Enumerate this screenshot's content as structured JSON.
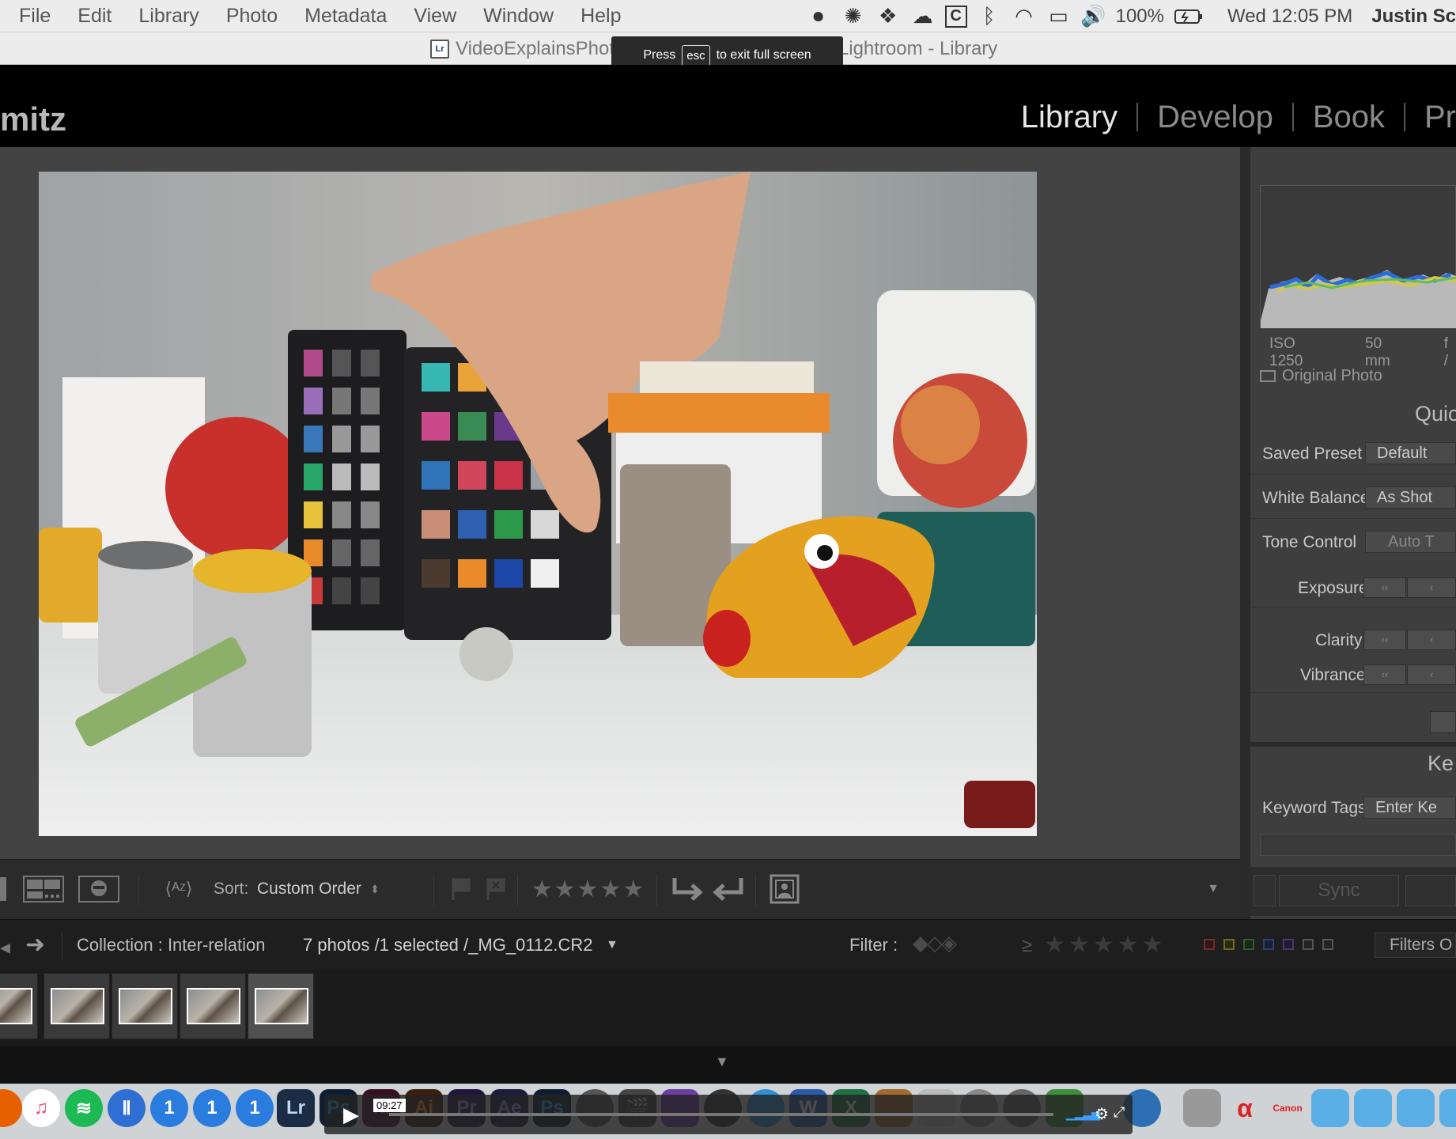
{
  "menubar": {
    "apple_menu": [
      "File",
      "Edit",
      "Library",
      "Photo",
      "Metadata",
      "View",
      "Window",
      "Help"
    ],
    "battery": "100%",
    "clock": "Wed 12:05 PM",
    "user": "Justin Sc"
  },
  "window": {
    "title": "VideoExplainsPhoto.lrcat - Adobe Photoshop Lightroom - Library",
    "fullscreen_tip": {
      "prefix": "Press",
      "key": "esc",
      "suffix": "to exit full screen"
    }
  },
  "lightroom": {
    "identity_plate": "mitz",
    "modules": [
      {
        "label": "Library",
        "active": true
      },
      {
        "label": "Develop",
        "active": false
      },
      {
        "label": "Book",
        "active": false
      },
      {
        "label": "Pr",
        "active": false
      }
    ]
  },
  "right_panel": {
    "histogram_meta": [
      "ISO 1250",
      "50 mm",
      "f /"
    ],
    "original_photo": "Original Photo",
    "quick_develop_title": "Quic",
    "saved_preset": {
      "label": "Saved Preset",
      "value": "Default"
    },
    "white_balance": {
      "label": "White Balance",
      "value": "As Shot"
    },
    "tone_control": {
      "label": "Tone Control",
      "value": "Auto T"
    },
    "exposure": "Exposure",
    "clarity": "Clarity",
    "vibrance": "Vibrance",
    "keywording_title": "Ke",
    "keyword_tags": {
      "label": "Keyword Tags",
      "value": "Enter Ke"
    },
    "sync_button": "Sync"
  },
  "toolbar": {
    "sort_label": "Sort:",
    "sort_value": "Custom Order"
  },
  "filmstrip_header": {
    "collection": "Collection : Inter-relation",
    "count": "7 photos /1 selected /_MG_0112.CR2",
    "filter_label": "Filter :",
    "filters_button": "Filters O"
  },
  "video": {
    "time": "09:27"
  },
  "dock": {
    "icons": [
      {
        "name": "itunes-icon",
        "glyph": "♫",
        "color": "#e94b6a"
      },
      {
        "name": "spotify-icon",
        "glyph": "≋",
        "color": "#1db954"
      },
      {
        "name": "onepassword-icon",
        "glyph": "1",
        "color": "#2f6fd3"
      },
      {
        "name": "lightroom-icon",
        "glyph": "Lr",
        "color": "#1b2d44"
      },
      {
        "name": "photoshop-icon",
        "glyph": "Ps",
        "color": "#0f1d30"
      },
      {
        "name": "illustrator-icon",
        "glyph": "Ai",
        "color": "#3a1f0c"
      },
      {
        "name": "premiere-icon",
        "glyph": "Pr",
        "color": "#22163f"
      },
      {
        "name": "aftereffects-icon",
        "glyph": "Ae",
        "color": "#1e1b3c"
      },
      {
        "name": "word-icon",
        "glyph": "W",
        "color": "#2a5bab"
      },
      {
        "name": "excel-icon",
        "glyph": "X",
        "color": "#1f7045"
      }
    ]
  },
  "colors": {
    "panel_bg": "#3e3e3e",
    "workspace_bg": "#434343",
    "toolbar_bg": "#2b2b2b",
    "accent_text": "#e6e6e6"
  }
}
